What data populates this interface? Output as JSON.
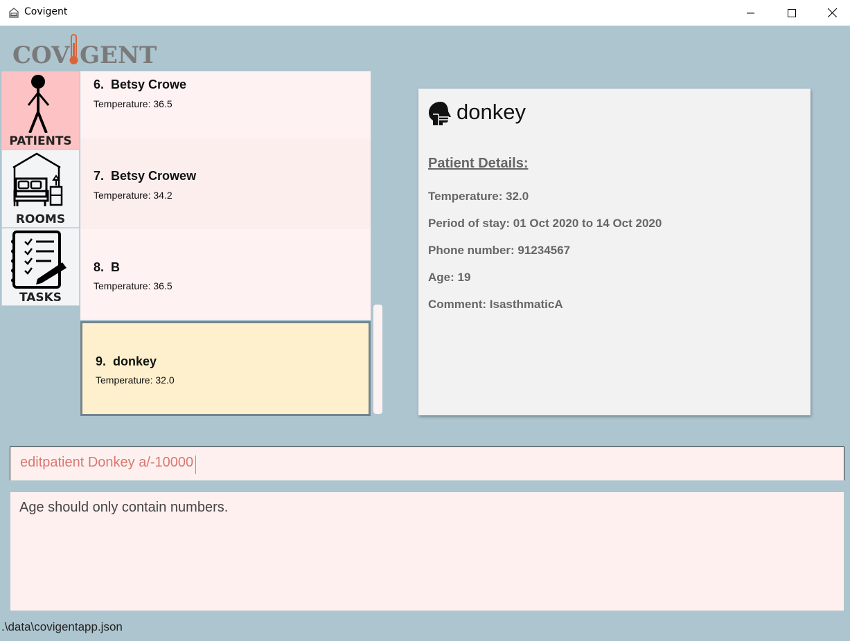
{
  "window": {
    "title": "Covigent"
  },
  "logo": {
    "text": "COVIGENT",
    "part_left": "COV",
    "part_right": "GENT",
    "color": "#7a7a7a",
    "thermometer_color": "#d9643a"
  },
  "nav": {
    "items": [
      {
        "label": "PATIENTS",
        "icon": "person-icon",
        "active": true
      },
      {
        "label": "ROOMS",
        "icon": "bed-icon",
        "active": false
      },
      {
        "label": "TASKS",
        "icon": "checklist-icon",
        "active": false
      }
    ]
  },
  "patient_list": {
    "items": [
      {
        "index": "6.",
        "name": "Betsy Crowe",
        "temperature": "Temperature: 36.5",
        "selected": false
      },
      {
        "index": "7.",
        "name": "Betsy Crowew",
        "temperature": "Temperature: 34.2",
        "selected": false
      },
      {
        "index": "8.",
        "name": "B",
        "temperature": "Temperature: 36.5",
        "selected": false
      },
      {
        "index": "9.",
        "name": "donkey",
        "temperature": "Temperature: 32.0",
        "selected": true
      }
    ]
  },
  "detail": {
    "name": "donkey",
    "icon": "patient-head-icon",
    "heading": "Patient Details:",
    "temperature": "Temperature: 32.0",
    "period": "Period of stay: 01 Oct 2020 to 14 Oct 2020",
    "phone": "Phone number: 91234567",
    "age": "Age: 19",
    "comment": "Comment: IsasthmaticA"
  },
  "command": {
    "value": "editpatient Donkey a/-10000"
  },
  "result": {
    "text": "Age should only contain numbers."
  },
  "status": {
    "path": ".\\data\\covigentapp.json"
  },
  "colors": {
    "background": "#adc5cf",
    "active_nav": "#fdc3c4",
    "selected_card": "#fef0cc",
    "command_text": "#d9786f"
  }
}
